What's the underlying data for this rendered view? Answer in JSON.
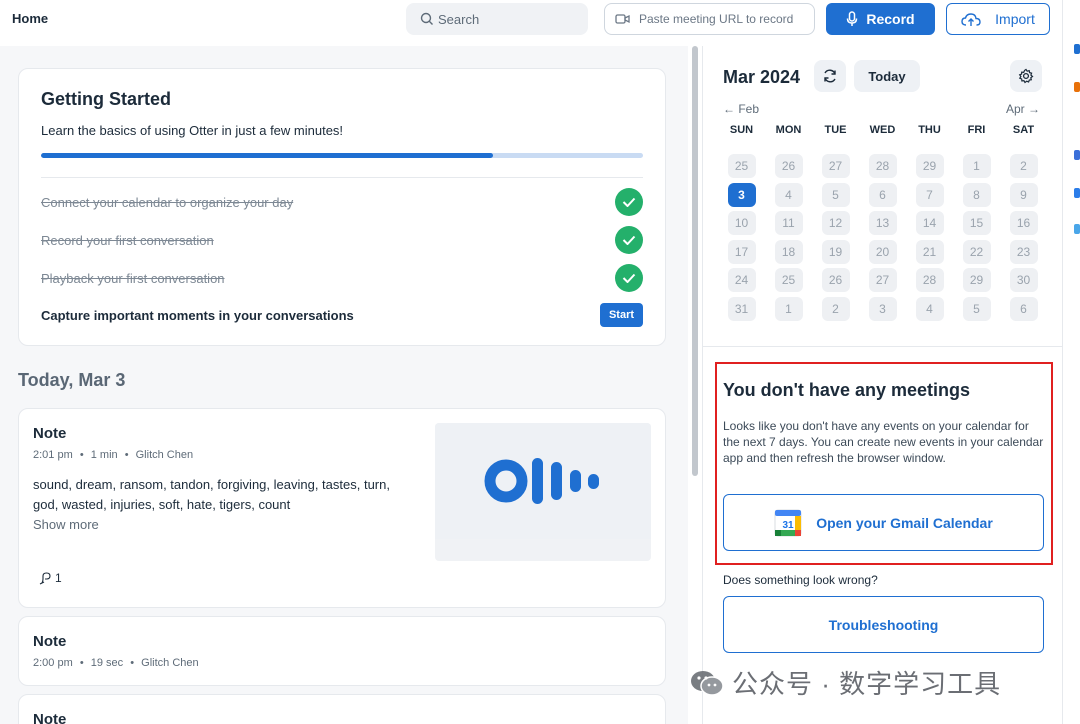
{
  "header": {
    "title": "Home",
    "search_placeholder": "Search",
    "url_placeholder": "Paste meeting URL to record",
    "record_label": "Record",
    "import_label": "Import"
  },
  "getting_started": {
    "title": "Getting Started",
    "subtitle": "Learn the basics of using Otter in just a few minutes!",
    "progress": 0.75,
    "tasks": [
      {
        "label": "Connect your calendar to organize your day",
        "done": true
      },
      {
        "label": "Record your first conversation",
        "done": true
      },
      {
        "label": "Playback your first conversation",
        "done": true
      },
      {
        "label": "Capture important moments in your conversations",
        "done": false,
        "action": "Start"
      }
    ]
  },
  "feed": {
    "day_heading": "Today, Mar 3",
    "notes": [
      {
        "title": "Note",
        "time": "2:01 pm",
        "duration": "1 min",
        "owner": "Glitch Chen",
        "keywords": "sound, dream, ransom, tandon, forgiving, leaving, tastes, turn, god, wasted, injuries, soft, hate, tigers, count",
        "show_more": "Show more",
        "comments": "1"
      },
      {
        "title": "Note",
        "time": "2:00 pm",
        "duration": "19 sec",
        "owner": "Glitch Chen"
      },
      {
        "title": "Note"
      }
    ],
    "meta_separator": "•"
  },
  "calendar": {
    "month_title": "Mar 2024",
    "today_label": "Today",
    "prev_label": "← Feb",
    "next_label": "Apr →",
    "weekdays": [
      "SUN",
      "MON",
      "TUE",
      "WED",
      "THU",
      "FRI",
      "SAT"
    ],
    "days": [
      "25",
      "26",
      "27",
      "28",
      "29",
      "1",
      "2",
      "3",
      "4",
      "5",
      "6",
      "7",
      "8",
      "9",
      "10",
      "11",
      "12",
      "13",
      "14",
      "15",
      "16",
      "17",
      "18",
      "19",
      "20",
      "21",
      "22",
      "23",
      "24",
      "25",
      "26",
      "27",
      "28",
      "29",
      "30",
      "31",
      "1",
      "2",
      "3",
      "4",
      "5",
      "6"
    ],
    "selected_index": 7
  },
  "meetings": {
    "title": "You don't have any meetings",
    "description": "Looks like you don't have any events on your calendar for the next 7 days. You can create new events in your calendar app and then refresh the browser window.",
    "gmail_button": "Open your Gmail Calendar",
    "gcal_icon_number": "31",
    "wrong_text": "Does something look wrong?",
    "troubleshoot_button": "Troubleshooting"
  },
  "watermark": {
    "text": "公众号 · 数字学习工具"
  },
  "colors": {
    "accent": "#1f6fd1",
    "success": "#24b06b",
    "highlight": "#e02020"
  }
}
